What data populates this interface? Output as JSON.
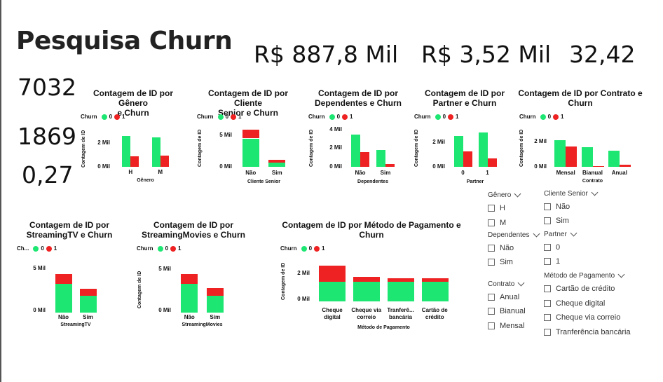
{
  "title": "Pesquisa Churn",
  "kpis": {
    "revenue_total": "R$ 887,8 Mil",
    "revenue_avg": "R$ 3,52 Mil",
    "tenure_avg": "32,42",
    "customers": "7032",
    "churned": "1869",
    "churn_rate": "0,27"
  },
  "colors": {
    "no_churn": "#1ee673",
    "churn": "#ee2222"
  },
  "legend": {
    "label": "Churn",
    "label_short": "Ch...",
    "v0": "0",
    "v1": "1"
  },
  "charts": [
    {
      "id": "genero",
      "title_l1": "Contagem de ID por Gênero",
      "title_l2": "e Churn",
      "ylabel": "Contagem de ID",
      "xlabel": "Gênero",
      "ticks": [
        "2 Mil",
        "0 Mil"
      ],
      "chart_data": {
        "type": "bar",
        "stacked": false,
        "categories": [
          "H",
          "M"
        ],
        "series": [
          {
            "name": "0",
            "values": [
              2620,
              2540
            ]
          },
          {
            "name": "1",
            "values": [
              930,
              940
            ]
          }
        ],
        "ylim": [
          0,
          3000
        ]
      }
    },
    {
      "id": "senior",
      "title_l1": "Contagem de ID por Cliente",
      "title_l2": "Senior e Churn",
      "ylabel": "Contagem de ID",
      "xlabel": "Cliente Senior",
      "ticks": [
        "5 Mil",
        "0 Mil"
      ],
      "chart_data": {
        "type": "bar",
        "stacked": true,
        "categories": [
          "Não",
          "Sim"
        ],
        "series": [
          {
            "name": "0",
            "values": [
              4500,
              670
            ]
          },
          {
            "name": "1",
            "values": [
              1400,
              480
            ]
          }
        ],
        "ylim": [
          0,
          6000
        ]
      }
    },
    {
      "id": "dependentes",
      "title_l1": "Contagem de ID por",
      "title_l2": "Dependentes e Churn",
      "ylabel": "Contagem de ID",
      "xlabel": "Dependentes",
      "ticks": [
        "4 Mil",
        "2 Mil",
        "0 Mil"
      ],
      "chart_data": {
        "type": "bar",
        "stacked": false,
        "categories": [
          "Não",
          "Sim"
        ],
        "series": [
          {
            "name": "0",
            "values": [
              3390,
              1780
            ]
          },
          {
            "name": "1",
            "values": [
              1540,
              330
            ]
          }
        ],
        "ylim": [
          0,
          4000
        ]
      }
    },
    {
      "id": "partner",
      "title_l1": "Contagem de ID por",
      "title_l2": "Partner e Churn",
      "ylabel": "Contagem de ID",
      "xlabel": "Partner",
      "ticks": [
        "2 Mil",
        "0 Mil"
      ],
      "chart_data": {
        "type": "bar",
        "stacked": false,
        "categories": [
          "0",
          "1"
        ],
        "series": [
          {
            "name": "0",
            "values": [
              2440,
              2730
            ]
          },
          {
            "name": "1",
            "values": [
              1200,
              670
            ]
          }
        ],
        "ylim": [
          0,
          3000
        ]
      }
    },
    {
      "id": "contrato",
      "title_l1": "Contagem de ID por Contrato e",
      "title_l2": "Churn",
      "ylabel": "Contagem de ID",
      "xlabel": "Contrato",
      "ticks": [
        "2 Mil",
        "0 Mil"
      ],
      "chart_data": {
        "type": "bar",
        "stacked": false,
        "categories": [
          "Mensal",
          "Bianual",
          "Anual"
        ],
        "series": [
          {
            "name": "0",
            "values": [
              2220,
              1640,
              1300
            ]
          },
          {
            "name": "1",
            "values": [
              1650,
              50,
              170
            ]
          }
        ],
        "ylim": [
          0,
          3000
        ]
      }
    },
    {
      "id": "streamingtv",
      "title_l1": "Contagem de ID por",
      "title_l2": "StreamingTV e Churn",
      "ylabel": "",
      "xlabel": "StreamingTV",
      "ticks": [
        "5 Mil",
        "0 Mil"
      ],
      "chart_data": {
        "type": "bar",
        "stacked": true,
        "categories": [
          "Não",
          "Sim"
        ],
        "series": [
          {
            "name": "0",
            "values": [
              3260,
              1890
            ]
          },
          {
            "name": "1",
            "values": [
              1070,
              810
            ]
          }
        ],
        "ylim": [
          0,
          5500
        ]
      }
    },
    {
      "id": "streamingmovies",
      "title_l1": "Contagem de ID por",
      "title_l2": "StreamingMovies e Churn",
      "ylabel": "Contagem de ID",
      "xlabel": "StreamingMovies",
      "ticks": [
        "5 Mil",
        "0 Mil"
      ],
      "chart_data": {
        "type": "bar",
        "stacked": true,
        "categories": [
          "Não",
          "Sim"
        ],
        "series": [
          {
            "name": "0",
            "values": [
              3250,
              1910
            ]
          },
          {
            "name": "1",
            "values": [
              1050,
              820
            ]
          }
        ],
        "ylim": [
          0,
          5500
        ]
      }
    },
    {
      "id": "pagamento",
      "title_l1": "Contagem de ID por Método de Pagamento e",
      "title_l2": "Churn",
      "ylabel": "Contagem de ID",
      "xlabel": "Método de Pagamento",
      "ticks": [
        "2 Mil",
        "0 Mil"
      ],
      "chart_data": {
        "type": "bar",
        "stacked": true,
        "categories": [
          "Cheque digital",
          "Cheque via correio",
          "Tranferê... bancária",
          "Cartão de crédito"
        ],
        "series": [
          {
            "name": "0",
            "values": [
              1290,
              1300,
              1280,
              1290
            ]
          },
          {
            "name": "1",
            "values": [
              1070,
              300,
              260,
              230
            ]
          }
        ],
        "ylim": [
          0,
          2500
        ]
      }
    }
  ],
  "slicers": {
    "genero": {
      "header": "Gênero",
      "options": [
        "H",
        "M"
      ]
    },
    "senior": {
      "header": "Cliente Senior",
      "options": [
        "Não",
        "Sim"
      ]
    },
    "dependentes": {
      "header": "Dependentes",
      "options": [
        "Não",
        "Sim"
      ]
    },
    "partner": {
      "header": "Partner",
      "options": [
        "0",
        "1"
      ]
    },
    "contrato": {
      "header": "Contrato",
      "options": [
        "Anual",
        "Bianual",
        "Mensal"
      ]
    },
    "pagamento": {
      "header": "Método de Pagamento",
      "options": [
        "Cartão de crédito",
        "Cheque digital",
        "Cheque via correio",
        "Tranferência bancária"
      ]
    }
  }
}
